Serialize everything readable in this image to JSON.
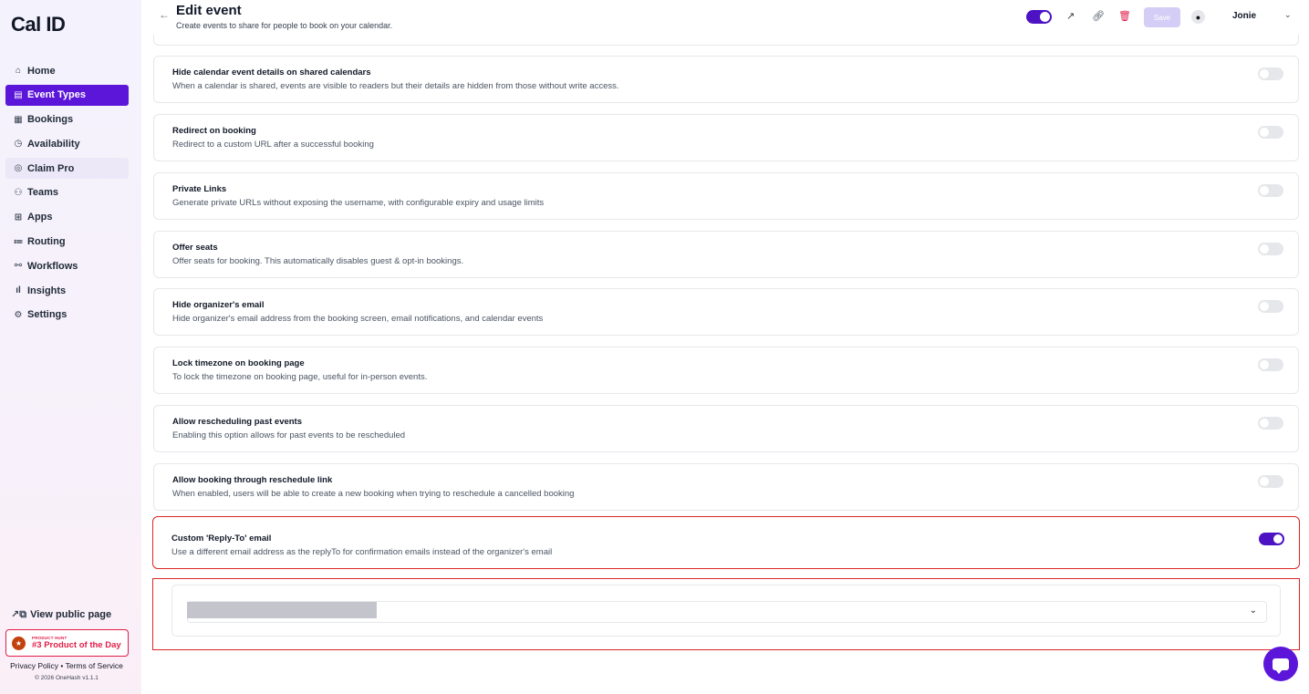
{
  "app": {
    "logo": "Cal ID"
  },
  "sidebar": {
    "items": [
      {
        "label": "Home",
        "icon": "home-icon",
        "glyph": "⌂"
      },
      {
        "label": "Event Types",
        "icon": "event-types-icon",
        "glyph": "▤",
        "active": true
      },
      {
        "label": "Bookings",
        "icon": "calendar-icon",
        "glyph": "▦"
      },
      {
        "label": "Availability",
        "icon": "clock-icon",
        "glyph": "◷"
      },
      {
        "label": "Claim Pro",
        "icon": "badge-icon",
        "glyph": "◎"
      },
      {
        "label": "Teams",
        "icon": "users-icon",
        "glyph": "⚇"
      },
      {
        "label": "Apps",
        "icon": "grid-icon",
        "glyph": "⊞"
      },
      {
        "label": "Routing",
        "icon": "routing-icon",
        "glyph": "≔"
      },
      {
        "label": "Workflows",
        "icon": "workflow-icon",
        "glyph": "⚯"
      },
      {
        "label": "Insights",
        "icon": "bar-chart-icon",
        "glyph": "ıl"
      },
      {
        "label": "Settings",
        "icon": "gear-icon",
        "glyph": "⚙"
      }
    ],
    "view_public": "View public page",
    "badge": {
      "small": "PRODUCT HUNT",
      "big": "#3 Product of the Day"
    },
    "legal": {
      "privacy": "Privacy Policy",
      "sep": "•",
      "terms": "Terms of Service"
    },
    "copyright": "© 2026 OneHash v1.1.1"
  },
  "header": {
    "title": "Edit event",
    "subtitle": "Create events to share for people to book on your calendar.",
    "save_label": "Save",
    "user": "Jonie"
  },
  "settings": [
    {
      "title": "Hide calendar event details on shared calendars",
      "desc": "When a calendar is shared, events are visible to readers but their details are hidden from those without write access.",
      "on": false
    },
    {
      "title": "Redirect on booking",
      "desc": "Redirect to a custom URL after a successful booking",
      "on": false
    },
    {
      "title": "Private Links",
      "desc": "Generate private URLs without exposing the username, with configurable expiry and usage limits",
      "on": false
    },
    {
      "title": "Offer seats",
      "desc": "Offer seats for booking. This automatically disables guest & opt-in bookings.",
      "on": false
    },
    {
      "title": "Hide organizer's email",
      "desc": "Hide organizer's email address from the booking screen, email notifications, and calendar events",
      "on": false
    },
    {
      "title": "Lock timezone on booking page",
      "desc": "To lock the timezone on booking page, useful for in-person events.",
      "on": false
    },
    {
      "title": "Allow rescheduling past events",
      "desc": "Enabling this option allows for past events to be rescheduled",
      "on": false
    },
    {
      "title": "Allow booking through reschedule link",
      "desc": "When enabled, users will be able to create a new booking when trying to reschedule a cancelled booking",
      "on": false
    },
    {
      "title": "Custom 'Reply-To' email",
      "desc": "Use a different email address as the replyTo for confirmation emails instead of the organizer's email",
      "on": true
    }
  ],
  "colors": {
    "accent": "#5b16d9",
    "highlight": "#dc2626",
    "danger": "#e11d48"
  }
}
